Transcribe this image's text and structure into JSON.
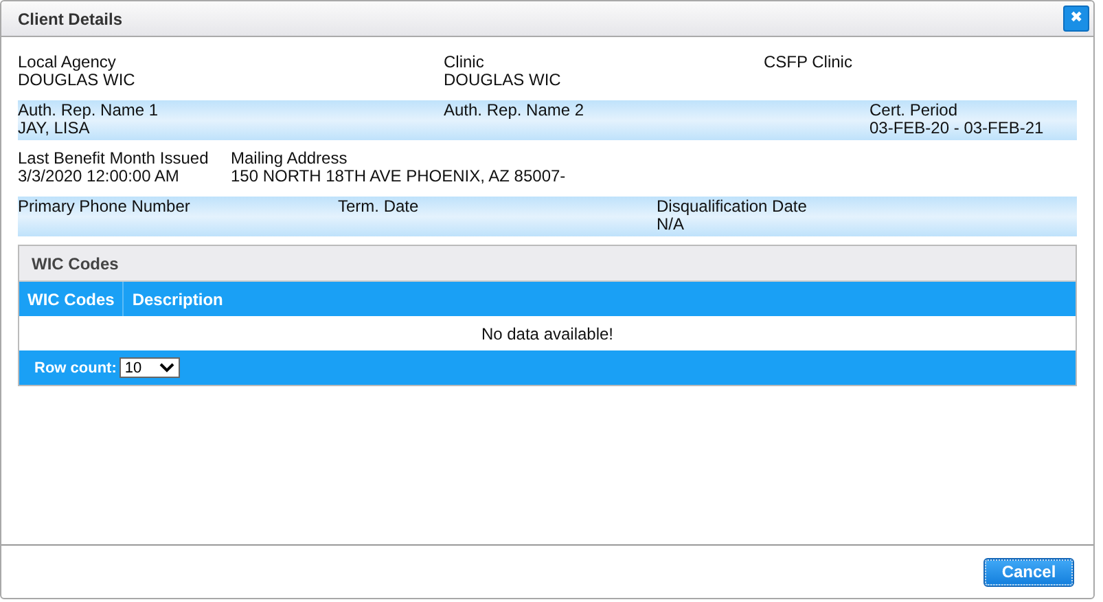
{
  "dialog": {
    "title": "Client Details",
    "close_icon": "✖"
  },
  "rows": [
    {
      "shaded": false,
      "fields": [
        {
          "label": "Local Agency",
          "value": "DOUGLAS WIC"
        },
        {
          "label": "Clinic",
          "value": "DOUGLAS WIC"
        },
        {
          "label": "CSFP Clinic"
        }
      ]
    },
    {
      "shaded": true,
      "fields": [
        {
          "label": "Auth. Rep. Name 1",
          "value": "JAY, LISA"
        },
        {
          "label": "Auth. Rep. Name 2"
        },
        {
          "label": "Cert. Period",
          "value": "03-FEB-20 - 03-FEB-21"
        }
      ]
    },
    {
      "shaded": false,
      "fields": [
        {
          "label": "Last Benefit Month Issued",
          "value": "3/3/2020 12:00:00 AM"
        },
        {
          "label": "Mailing Address",
          "value": "150 NORTH 18TH AVE PHOENIX, AZ 85007-"
        }
      ]
    },
    {
      "shaded": true,
      "fields": [
        {
          "label": "Primary Phone Number"
        },
        {
          "label": "Term. Date"
        },
        {
          "label": "Disqualification Date",
          "value": "N/A"
        }
      ]
    }
  ],
  "wic_codes": {
    "title": "WIC Codes",
    "columns": [
      "WIC Codes",
      "Description"
    ],
    "empty_message": "No data available!",
    "row_count": {
      "label": "Row count:",
      "value": "10"
    }
  },
  "buttons": [
    "Cancel"
  ]
}
